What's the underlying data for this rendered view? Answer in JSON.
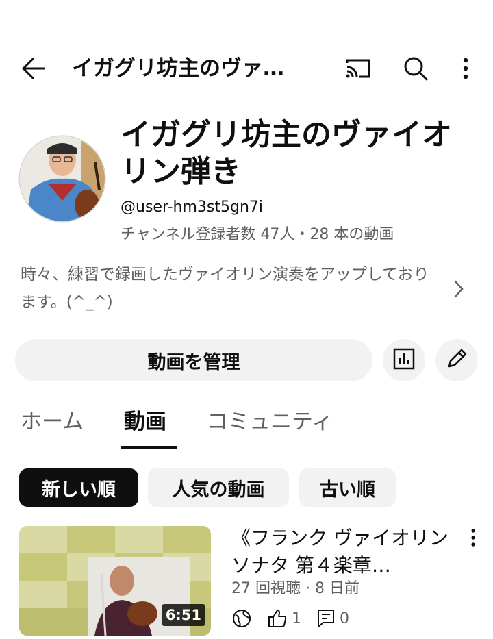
{
  "header": {
    "title": "イガグリ坊主のヴァ…",
    "back_icon": "arrow-left-icon",
    "cast_icon": "cast-icon",
    "search_icon": "search-icon",
    "more_icon": "more-vertical-icon"
  },
  "channel": {
    "name": "イガグリ坊主のヴァイオリン弾き",
    "handle": "@user-hm3st5gn7i",
    "stats": "チャンネル登録者数 47人・28 本の動画",
    "description": "時々、練習で録画したヴァイオリン演奏をアップしております。(^_^)",
    "avatar_icon": "avatar"
  },
  "actions": {
    "manage_label": "動画を管理",
    "analytics_icon": "analytics-icon",
    "edit_icon": "pencil-icon"
  },
  "tabs": [
    {
      "label": "ホーム"
    },
    {
      "label": "動画"
    },
    {
      "label": "コミュニティ"
    }
  ],
  "active_tab": "動画",
  "chips": [
    {
      "label": "新しい順"
    },
    {
      "label": "人気の動画"
    },
    {
      "label": "古い順"
    }
  ],
  "video": {
    "title": "《フランク ヴァイオリンソナタ 第４楽章…",
    "duration": "6:51",
    "meta": "27 回視聴 · 8 日前",
    "likes": "1",
    "comments": "0"
  },
  "colors": {
    "text_primary": "#0f0f0f",
    "text_secondary": "#606060",
    "chip_bg": "#f2f2f2",
    "chip_active_bg": "#0f0f0f"
  }
}
